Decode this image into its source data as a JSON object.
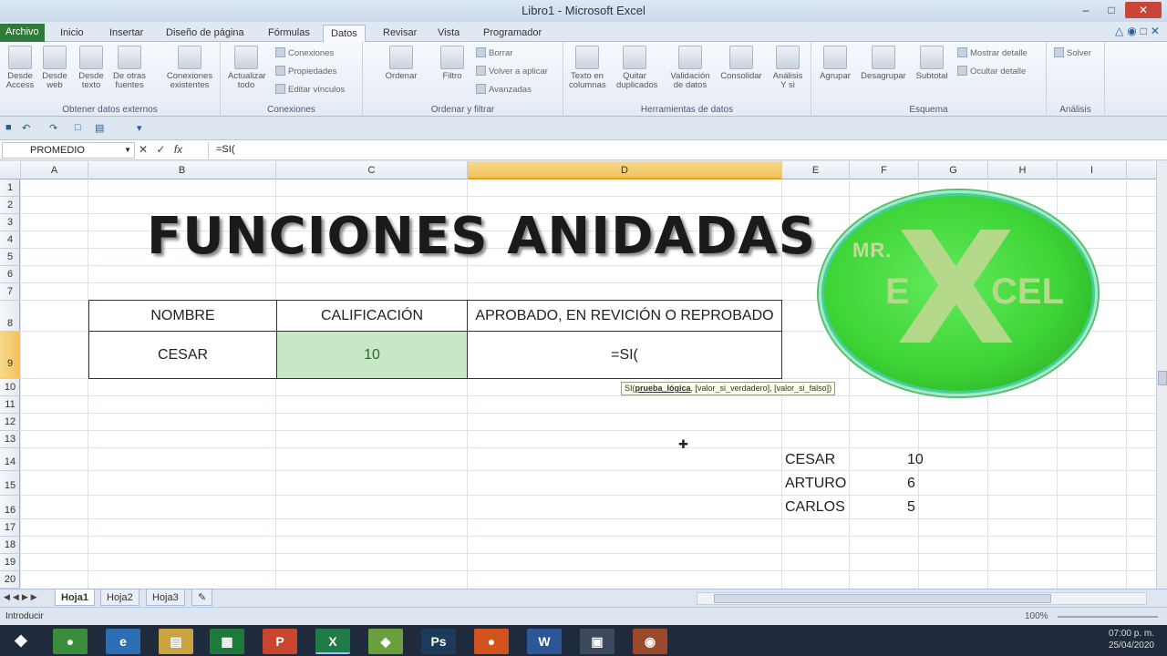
{
  "window": {
    "title": "Libro1 - Microsoft Excel"
  },
  "tabs": [
    "Archivo",
    "Inicio",
    "Insertar",
    "Diseño de página",
    "Fórmulas",
    "Datos",
    "Revisar",
    "Vista",
    "Programador"
  ],
  "active_tab": "Datos",
  "ribbon": {
    "groups": [
      {
        "name": "Obtener datos externos",
        "buttons": [
          "Desde Access",
          "Desde web",
          "Desde texto",
          "De otras fuentes",
          "Conexiones existentes"
        ]
      },
      {
        "name": "Conexiones",
        "buttons": [
          "Actualizar todo"
        ],
        "small": [
          "Conexiones",
          "Propiedades",
          "Editar vínculos"
        ]
      },
      {
        "name": "Ordenar y filtrar",
        "buttons": [
          "Ordenar",
          "Filtro"
        ],
        "small": [
          "Borrar",
          "Volver a aplicar",
          "Avanzadas"
        ]
      },
      {
        "name": "Herramientas de datos",
        "buttons": [
          "Texto en columnas",
          "Quitar duplicados",
          "Validación de datos",
          "Consolidar",
          "Análisis Y si"
        ]
      },
      {
        "name": "Esquema",
        "buttons": [
          "Agrupar",
          "Desagrupar",
          "Subtotal"
        ],
        "small": [
          "Mostrar detalle",
          "Ocultar detalle"
        ]
      },
      {
        "name": "Análisis",
        "small": [
          "Solver"
        ]
      }
    ]
  },
  "formula_bar": {
    "name_box": "PROMEDIO",
    "content": "=SI("
  },
  "columns": [
    "A",
    "B",
    "C",
    "D",
    "E",
    "F",
    "G",
    "H",
    "I"
  ],
  "selected_column": "D",
  "rows": [
    "1",
    "2",
    "3",
    "4",
    "5",
    "6",
    "7",
    "8",
    "9",
    "10",
    "11",
    "12",
    "13",
    "14",
    "15",
    "16",
    "17",
    "18",
    "19",
    "20"
  ],
  "selected_row": "9",
  "sheet": {
    "big_title": "FUNCIONES ANIDADAS",
    "table": {
      "headers": [
        "NOMBRE",
        "CALIFICACIÓN",
        "APROBADO, EN REVICIÓN O REPROBADO"
      ],
      "row": [
        "CESAR",
        "10",
        "=SI("
      ]
    },
    "tooltip": {
      "func": "SI(",
      "arg1": "prueba_lógica",
      "rest": ", [valor_si_verdadero], [valor_si_falso])"
    },
    "list": [
      {
        "name": "CESAR",
        "value": "10"
      },
      {
        "name": "ARTURO",
        "value": "6"
      },
      {
        "name": "CARLOS",
        "value": "5"
      }
    ],
    "logo": {
      "mr": "MR.",
      "e": "E",
      "x": "X",
      "cel": "CEL"
    }
  },
  "sheet_tabs": [
    "Hoja1",
    "Hoja2",
    "Hoja3"
  ],
  "active_sheet": "Hoja1",
  "status": {
    "mode": "Introducir",
    "zoom": "100%"
  },
  "taskbar": {
    "time": "07:00 p. m.",
    "date": "25/04/2020"
  }
}
